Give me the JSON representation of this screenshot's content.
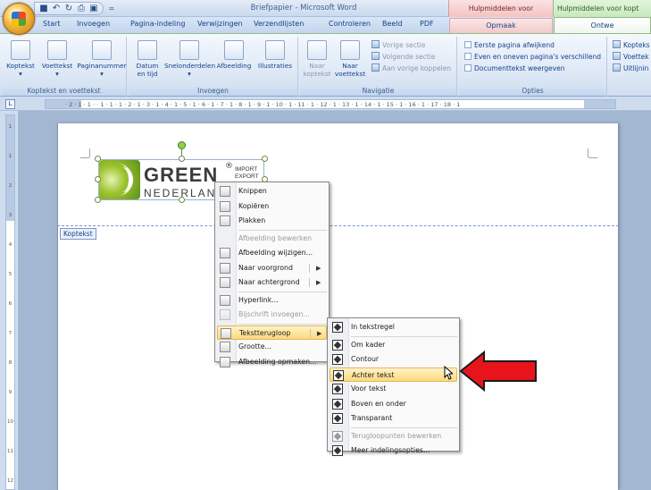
{
  "window": {
    "title": "Briefpapier - Microsoft Word",
    "context_picture_tools": "Hulpmiddelen voor afbeeldingen",
    "context_header_tools": "Hulpmiddelen voor kopt"
  },
  "qat": {
    "icons": [
      "save-icon",
      "undo-icon",
      "redo-icon",
      "print-icon",
      "preview-icon"
    ],
    "overflow": "="
  },
  "tabs": [
    "Start",
    "Invoegen",
    "Pagina-indeling",
    "Verwijzingen",
    "Verzendlijsten",
    "Controleren",
    "Beeld",
    "PDF"
  ],
  "context_tabs": {
    "opmaak": "Opmaak",
    "ontwerpen": "Ontwe"
  },
  "ribbon": {
    "group1": {
      "label": "Koptekst en voettekst",
      "buttons": [
        "Koptekst",
        "Voettekst",
        "Paginanummer"
      ]
    },
    "group2": {
      "label": "Invoegen",
      "buttons": [
        "Datum en tijd",
        "Snelonderdelen",
        "Afbeelding",
        "Illustraties"
      ]
    },
    "group3": {
      "label": "Navigatie",
      "buttons": [
        "Naar koptekst",
        "Naar voettekst"
      ],
      "small": [
        "Vorige sectie",
        "Volgende sectie",
        "Aan vorige koppelen"
      ]
    },
    "group4": {
      "label": "Opties",
      "checks": [
        "Eerste pagina afwijkend",
        "Even en oneven pagina's verschillend",
        "Documenttekst weergeven"
      ]
    },
    "group5": {
      "items": [
        "Kopteks",
        "Voettek",
        "Uitlijnin"
      ]
    }
  },
  "ruler": {
    "h_labels": "· 2 · 1 · 1 ·  · 1 · 1 · 1 · 2 · 1 · 3 · 1 · 4 · 1 · 5 · 1 · 6 · 1 · 7 · 1 · 8 · 1 · 9 · 1 · 10 · 1 · 11 · 1 · 12 · 1 · 13 · 1 · 14 · 1 · 15 · 1 · 16 · 1 · 17 · 18 · 1",
    "v_labels": [
      "1",
      "1",
      "2",
      "3",
      "4",
      "5",
      "6",
      "7",
      "8",
      "9",
      "10",
      "11",
      "12"
    ]
  },
  "document": {
    "header_tag": "Koptekst",
    "logo": {
      "word1": "GREEN",
      "reg": "®",
      "sub1": "IMPORT",
      "sub2": "EXPORT",
      "word2": "NEDERLAND"
    }
  },
  "context_menu": [
    {
      "label": "Knippen",
      "icon": "scissors-icon",
      "enabled": true
    },
    {
      "label": "Kopiëren",
      "icon": "copy-icon",
      "enabled": true
    },
    {
      "label": "Plakken",
      "icon": "paste-icon",
      "enabled": true
    },
    {
      "label": "Afbeelding bewerken",
      "icon": "",
      "enabled": false
    },
    {
      "label": "Afbeelding wijzigen...",
      "icon": "change-picture-icon",
      "enabled": true
    },
    {
      "label": "Naar voorgrond",
      "icon": "bring-front-icon",
      "enabled": true,
      "submenu": true
    },
    {
      "label": "Naar achtergrond",
      "icon": "send-back-icon",
      "enabled": true,
      "submenu": true
    },
    {
      "label": "Hyperlink...",
      "icon": "hyperlink-icon",
      "enabled": true
    },
    {
      "label": "Bijschrift invoegen...",
      "icon": "caption-icon",
      "enabled": false
    },
    {
      "label": "Tekstterugloop",
      "icon": "text-wrap-icon",
      "enabled": true,
      "submenu": true,
      "highlighted": true
    },
    {
      "label": "Grootte...",
      "icon": "size-icon",
      "enabled": true
    },
    {
      "label": "Afbeelding opmaken...",
      "icon": "format-picture-icon",
      "enabled": true
    }
  ],
  "submenu": [
    {
      "label": "In tekstregel",
      "enabled": true
    },
    {
      "label": "Om kader",
      "enabled": true
    },
    {
      "label": "Contour",
      "enabled": true
    },
    {
      "label": "Achter tekst",
      "enabled": true,
      "highlighted": true
    },
    {
      "label": "Voor tekst",
      "enabled": true
    },
    {
      "label": "Boven en onder",
      "enabled": true
    },
    {
      "label": "Transparant",
      "enabled": true
    },
    {
      "label": "Terugloopunten bewerken",
      "enabled": false
    },
    {
      "label": "Meer indelingsopties...",
      "enabled": true
    }
  ],
  "colors": {
    "arrow": "#e8141b",
    "highlight": "#fcd97b",
    "ribbon": "#dfe9f6"
  }
}
